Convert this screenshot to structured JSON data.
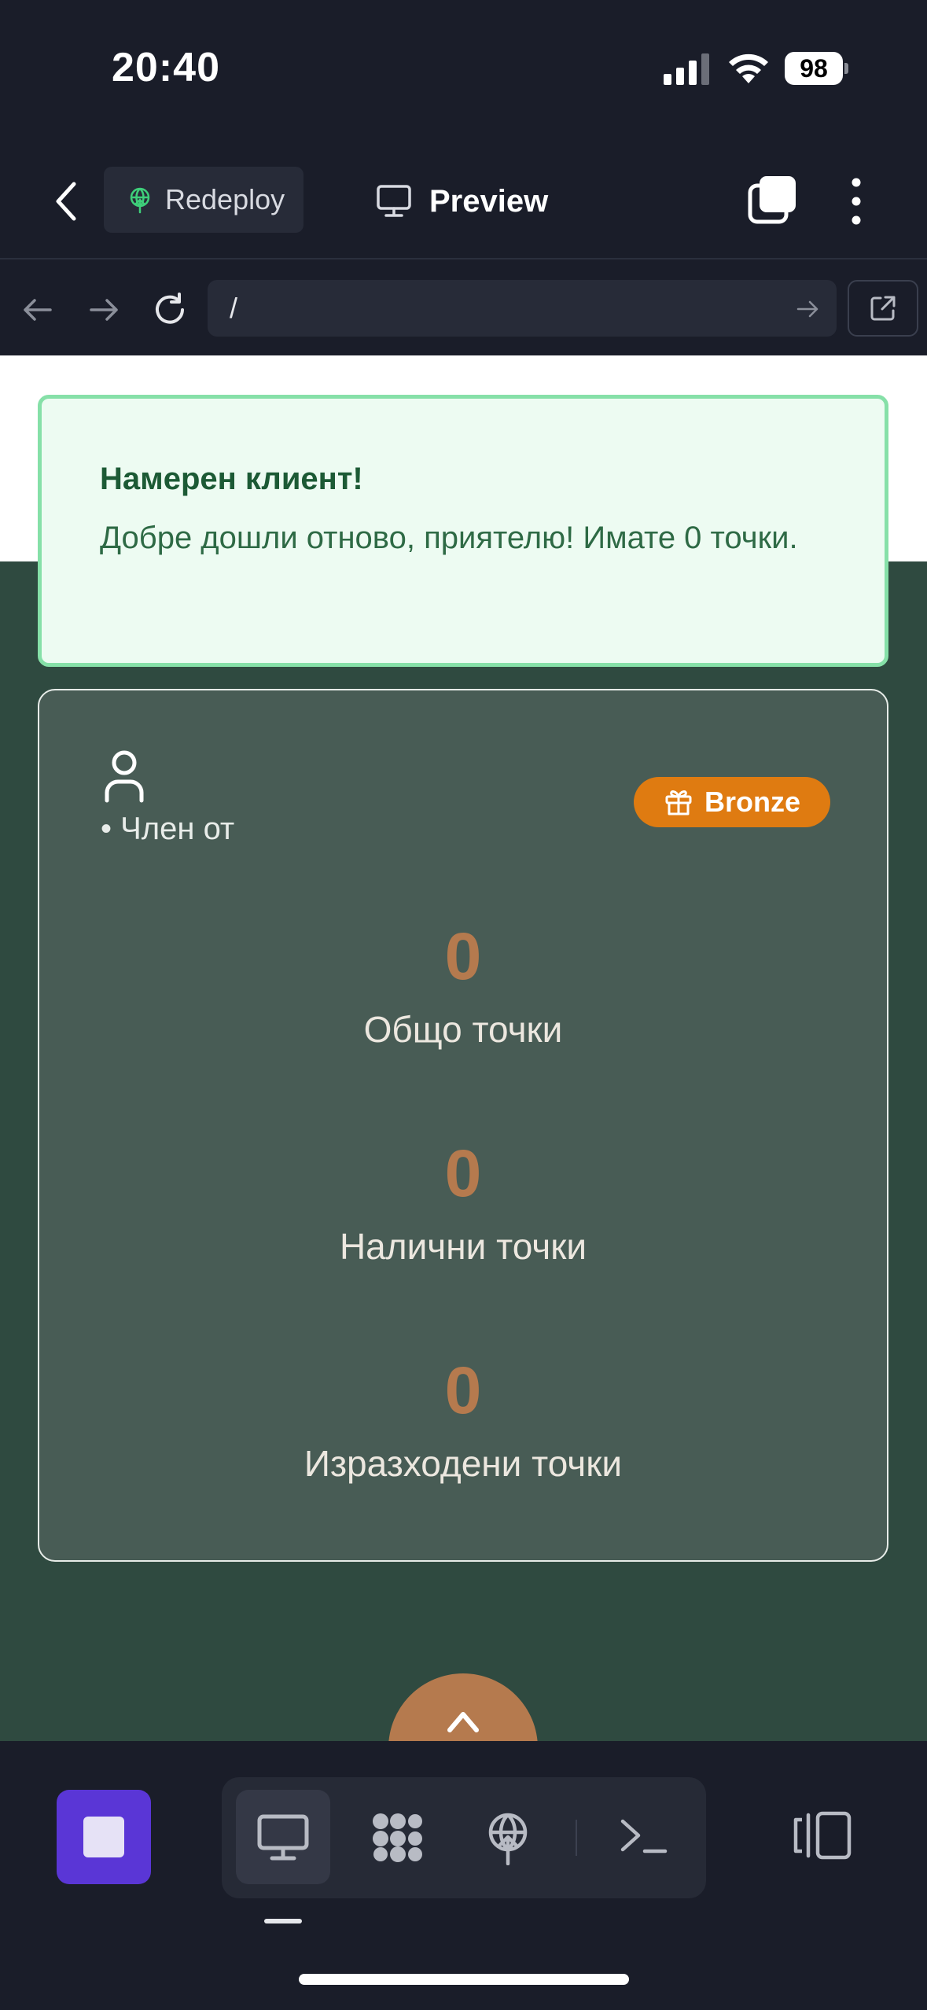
{
  "status_bar": {
    "time": "20:40",
    "battery": "98"
  },
  "nav": {
    "redeploy_label": "Redeploy",
    "preview_label": "Preview"
  },
  "url_bar": {
    "url": "/"
  },
  "toast": {
    "title": "Намерен клиент!",
    "message": "Добре дошли отново, приятелю! Имате 0 точки."
  },
  "card": {
    "member_since": "• Член от",
    "tier": "Bronze",
    "stats": [
      {
        "value": "0",
        "label": "Общо точки"
      },
      {
        "value": "0",
        "label": "Налични точки"
      },
      {
        "value": "0",
        "label": "Изразходени точки"
      }
    ]
  },
  "colors": {
    "page_background": "#2f4a40",
    "card_background": "#485c55",
    "accent_points": "#b57a4e",
    "tier_badge": "#df7b11",
    "toast_background": "#edfbf2",
    "toast_border": "#86e0a8",
    "stop_button": "#5a36d6"
  },
  "icons": {
    "back": "chevron-left-icon",
    "redeploy": "globe-upload-icon",
    "preview": "monitor-icon",
    "tabs": "tabs-icon",
    "more": "kebab-icon",
    "user": "user-icon",
    "tier": "gift-icon",
    "console": "terminal-icon",
    "layout": "layout-icon"
  }
}
